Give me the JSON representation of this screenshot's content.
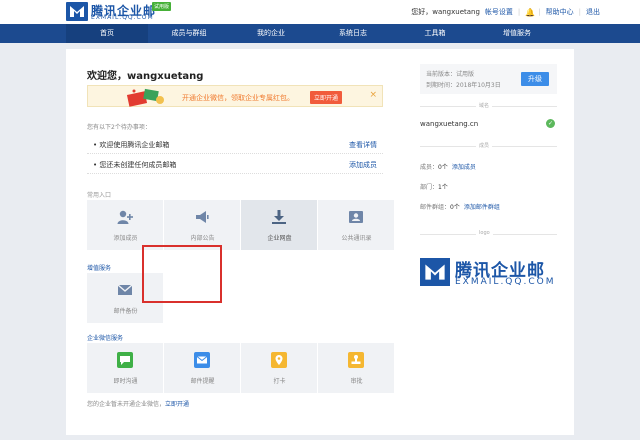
{
  "header": {
    "logo_text": "腾讯企业邮",
    "logo_sub": "EXMAIL.QQ.COM",
    "trial_badge": "试用版",
    "greeting": "您好，wangxuetang",
    "account_settings": "帐号设置",
    "help_center": "帮助中心",
    "logout": "退出"
  },
  "nav": {
    "items": [
      {
        "label": "首页",
        "active": true
      },
      {
        "label": "成员与群组",
        "active": false
      },
      {
        "label": "我的企业",
        "active": false
      },
      {
        "label": "系统日志",
        "active": false
      },
      {
        "label": "工具箱",
        "active": false
      },
      {
        "label": "增值服务",
        "active": false
      }
    ]
  },
  "main": {
    "welcome": "欢迎您，wangxuetang",
    "banner": {
      "text": "开通企业微信，领取企业专属红包。",
      "button": "立即开通",
      "close": "×"
    },
    "todo": {
      "title": "您有以下2个待办事项：",
      "items": [
        {
          "text": "•  欢迎使用腾讯企业邮箱",
          "link": "查看详情"
        },
        {
          "text": "•  您还未创建任何成员邮箱",
          "link": "添加成员"
        }
      ]
    },
    "common_entry": {
      "title": "常用入口",
      "tiles": [
        "添加成员",
        "内部公告",
        "企业网盘",
        "公共通讯录"
      ]
    },
    "value_added": {
      "title": "增值服务",
      "tiles": [
        "邮件备份"
      ]
    },
    "wework": {
      "title": "企业微信服务",
      "tiles": [
        "即时沟通",
        "邮件提醒",
        "打卡",
        "审批"
      ]
    },
    "footer_note": "您的企业暂未开通企业微信，",
    "footer_link": "立即开通"
  },
  "sidebar": {
    "version_label": "当前版本：试用版",
    "expire_label": "到期时间：2018年10月3日",
    "upgrade": "升级",
    "domain_caption": "域名",
    "domain": "wangxuetang.cn",
    "members_caption": "成员",
    "members_label": "成员：",
    "members_value": "0个",
    "members_link": "添加成员",
    "dept_label": "部门：",
    "dept_value": "1个",
    "group_label": "邮件群组：",
    "group_value": "0个",
    "group_link": "添加邮件群组",
    "logo_caption": "logo",
    "logo_text": "腾讯企业邮",
    "logo_sub": "EXMAIL.QQ.COM"
  },
  "colors": {
    "brand": "#1c56a7",
    "nav": "#1c4a8f",
    "highlight": "#d9302c",
    "upgrade": "#3c8de8"
  }
}
